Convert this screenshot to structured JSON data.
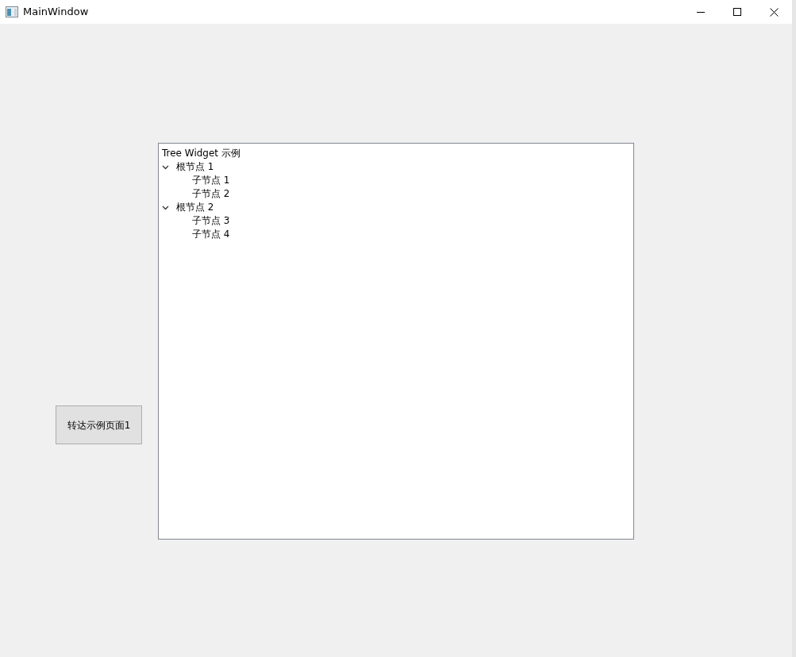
{
  "window": {
    "title": "MainWindow"
  },
  "button": {
    "label": "转达示例页面1"
  },
  "tree": {
    "header": "Tree Widget 示例",
    "items": [
      {
        "label": "根节点 1",
        "expanded": true,
        "children": [
          {
            "label": "子节点 1"
          },
          {
            "label": "子节点 2"
          }
        ]
      },
      {
        "label": "根节点 2",
        "expanded": true,
        "children": [
          {
            "label": "子节点 3"
          },
          {
            "label": "子节点 4"
          }
        ]
      }
    ]
  }
}
